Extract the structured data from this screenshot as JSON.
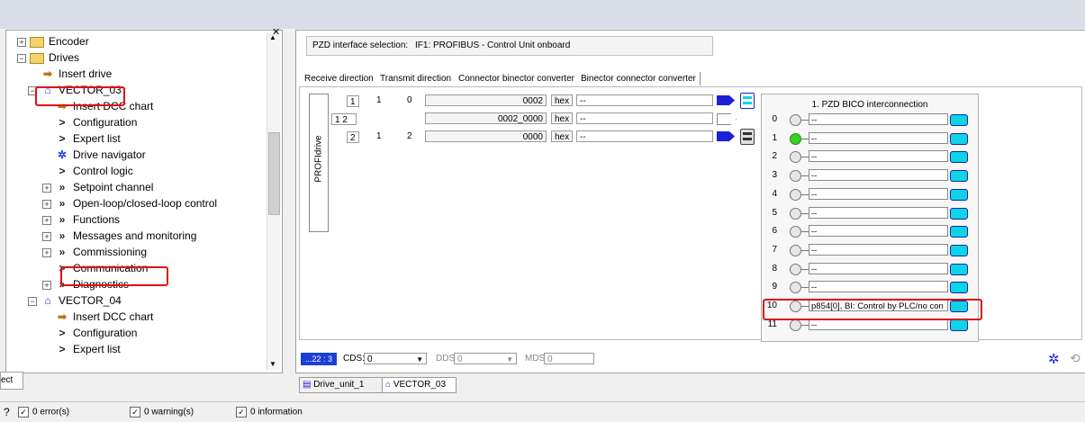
{
  "tree": {
    "items": [
      {
        "label": "Encoder",
        "expander": "+",
        "icon": "folder-icon"
      },
      {
        "label": "Drives",
        "expander": "-",
        "icon": "folder-icon"
      },
      {
        "label": "Insert drive",
        "expander": "",
        "icon": "insert-icon"
      },
      {
        "label": "VECTOR_03",
        "expander": "-",
        "icon": "drive-icon"
      },
      {
        "label": "Insert DCC chart",
        "expander": "",
        "icon": "insert-icon"
      },
      {
        "label": "Configuration",
        "expander": "",
        "icon": "chevron-right-icon"
      },
      {
        "label": "Expert list",
        "expander": "",
        "icon": "chevron-right-icon"
      },
      {
        "label": "Drive navigator",
        "expander": "",
        "icon": "navigator-icon"
      },
      {
        "label": "Control logic",
        "expander": "",
        "icon": "chevron-right-icon"
      },
      {
        "label": "Setpoint channel",
        "expander": "+",
        "icon": "double-chevron-icon"
      },
      {
        "label": "Open-loop/closed-loop control",
        "expander": "+",
        "icon": "double-chevron-icon"
      },
      {
        "label": "Functions",
        "expander": "+",
        "icon": "double-chevron-icon"
      },
      {
        "label": "Messages and monitoring",
        "expander": "+",
        "icon": "double-chevron-icon"
      },
      {
        "label": "Commissioning",
        "expander": "+",
        "icon": "double-chevron-icon"
      },
      {
        "label": "Communication",
        "expander": "",
        "icon": "chevron-right-icon"
      },
      {
        "label": "Diagnostics",
        "expander": "+",
        "icon": "double-chevron-icon"
      },
      {
        "label": "VECTOR_04",
        "expander": "-",
        "icon": "drive-icon"
      },
      {
        "label": "Insert DCC chart",
        "expander": "",
        "icon": "insert-icon"
      },
      {
        "label": "Configuration",
        "expander": "",
        "icon": "chevron-right-icon"
      },
      {
        "label": "Expert list",
        "expander": "",
        "icon": "chevron-right-icon"
      }
    ],
    "left_tab_stub": "ect"
  },
  "pzd": {
    "selection_label": "PZD interface selection:",
    "selection_value": "IF1:  PROFIBUS - Control Unit onboard"
  },
  "tabs": [
    "Receive direction",
    "Transmit direction",
    "Connector binector converter",
    "Binector connector converter"
  ],
  "profidrive_label": "PROFIdrive",
  "rows": [
    {
      "a": "1",
      "b": "1",
      "c": "0",
      "value": "0002",
      "unit": "hex",
      "target": "--"
    },
    {
      "a": "1",
      "a2": "2",
      "value": "0002_0000",
      "unit": "hex",
      "target": "--"
    },
    {
      "a": "2",
      "b": "1",
      "c": "2",
      "value": "0000",
      "unit": "hex",
      "target": "--"
    }
  ],
  "bico": {
    "title": "1. PZD BICO interconnection",
    "rows": [
      {
        "n": "0",
        "text": "--",
        "green": false
      },
      {
        "n": "1",
        "text": "--",
        "green": true
      },
      {
        "n": "2",
        "text": "--",
        "green": false
      },
      {
        "n": "3",
        "text": "--",
        "green": false
      },
      {
        "n": "4",
        "text": "--",
        "green": false
      },
      {
        "n": "5",
        "text": "--",
        "green": false
      },
      {
        "n": "6",
        "text": "--",
        "green": false
      },
      {
        "n": "7",
        "text": "--",
        "green": false
      },
      {
        "n": "8",
        "text": "--",
        "green": false
      },
      {
        "n": "9",
        "text": "--",
        "green": false
      },
      {
        "n": "10",
        "text": "p854[0], BI: Control by PLC/no con",
        "green": false
      },
      {
        "n": "11",
        "text": "--",
        "green": false
      }
    ]
  },
  "bottom": {
    "indicator": "...22 : 3",
    "cds_label": "CDS:",
    "cds_value": "0",
    "dds_label": "DDS:",
    "dds_value": "0",
    "mds_label": "MDS:",
    "mds_value": "0"
  },
  "doc_tabs": [
    "Drive_unit_1",
    "VECTOR_03"
  ],
  "status": {
    "errors": "0 error(s)",
    "warnings": "0 warning(s)",
    "info": "0 information"
  },
  "colors": {
    "highlight": "#e01010",
    "connector": "#0fd3e6",
    "led_active": "#3ccf2a"
  }
}
